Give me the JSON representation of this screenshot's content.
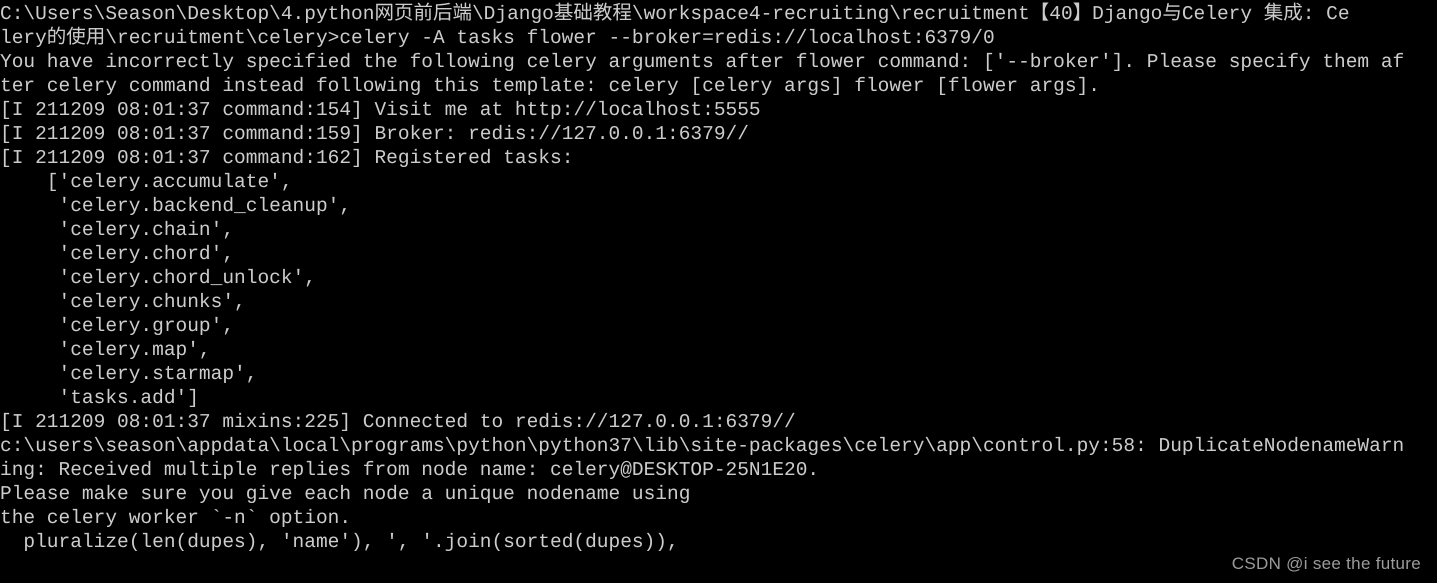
{
  "terminal": {
    "background_color": "#000000",
    "text_color": "#cccccc",
    "watermark": "CSDN @i see the future",
    "watermark_color": "#9b9b9b",
    "lines": [
      "C:\\Users\\Season\\Desktop\\4.python网页前后端\\Django基础教程\\workspace4-recruiting\\recruitment【40】Django与Celery 集成: Ce",
      "lery的使用\\recruitment\\celery>celery -A tasks flower --broker=redis://localhost:6379/0",
      "You have incorrectly specified the following celery arguments after flower command: ['--broker']. Please specify them af",
      "ter celery command instead following this template: celery [celery args] flower [flower args].",
      "[I 211209 08:01:37 command:154] Visit me at http://localhost:5555",
      "[I 211209 08:01:37 command:159] Broker: redis://127.0.0.1:6379//",
      "[I 211209 08:01:37 command:162] Registered tasks: ",
      "    ['celery.accumulate',",
      "     'celery.backend_cleanup',",
      "     'celery.chain',",
      "     'celery.chord',",
      "     'celery.chord_unlock',",
      "     'celery.chunks',",
      "     'celery.group',",
      "     'celery.map',",
      "     'celery.starmap',",
      "     'tasks.add']",
      "[I 211209 08:01:37 mixins:225] Connected to redis://127.0.0.1:6379//",
      "c:\\users\\season\\appdata\\local\\programs\\python\\python37\\lib\\site-packages\\celery\\app\\control.py:58: DuplicateNodenameWarn",
      "ing: Received multiple replies from node name: celery@DESKTOP-25N1E20.",
      "Please make sure you give each node a unique nodename using",
      "the celery worker `-n` option.",
      "  pluralize(len(dupes), 'name'), ', '.join(sorted(dupes)),"
    ]
  }
}
